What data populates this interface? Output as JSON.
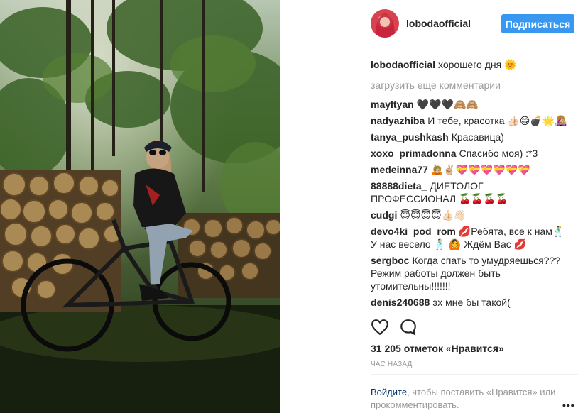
{
  "post": {
    "username": "lobodaofficial",
    "follow_label": "Подписаться",
    "caption": {
      "author": "lobodaofficial",
      "text": "хорошего дня 🌞"
    },
    "load_more": "загрузить еще комментарии",
    "comments": [
      {
        "author": "mayltyan",
        "text": "🖤🖤🖤🙈🙈"
      },
      {
        "author": "nadyazhiba",
        "text": "И тебе, красотка 👍🏻😁💣🌟👩🏼‍🎤"
      },
      {
        "author": "tanya_pushkash",
        "text": "Красавица)"
      },
      {
        "author": "xoxo_primadonna",
        "text": "Спасибо моя) :*3"
      },
      {
        "author": "medeinna77",
        "text": "🙇🏼✌🏼💝💝💝💝💝💝"
      },
      {
        "author": "88888dieta_",
        "text": "ДИЕТОЛОГ ПРОФЕССИОНАЛ 🍒🍒🍒🍒"
      },
      {
        "author": "cudgi",
        "text": "😇😇😇😇👍🏻👋🏻"
      },
      {
        "author": "devo4ki_pod_rom",
        "text": "💋Ребята, все к нам🕺У нас весело 🕺 🙆 Ждём Вас 💋"
      },
      {
        "author": "sergboc",
        "text": "Когда спать то умудряешься??? Режим работы должен быть утомительны!!!!!!!"
      },
      {
        "author": "denis240688",
        "text": "эх мне бы такой("
      }
    ],
    "likes_text": "31 205 отметок «Нравится»",
    "time_text": "ЧАС НАЗАД",
    "footer": {
      "login_link": "Войдите",
      "text": ", чтобы поставить «Нравится» или прокомментировать."
    },
    "more_label": "•••",
    "icons": {
      "like": "heart-icon",
      "comment": "comment-icon"
    },
    "colors": {
      "accent": "#3897f0",
      "muted": "#999999",
      "link": "#003569"
    }
  }
}
